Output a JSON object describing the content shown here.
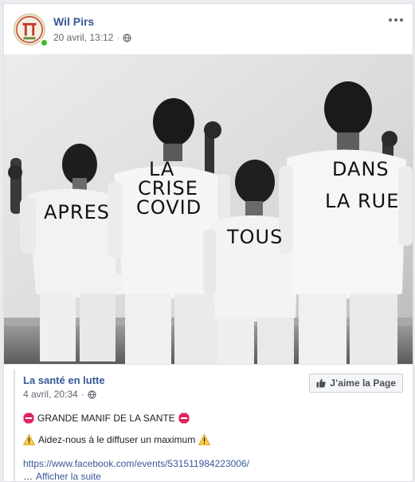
{
  "post": {
    "author": "Wil Pirs",
    "date": "20 avril, 13:12",
    "separator": "·",
    "privacy_icon": "globe-icon",
    "more_icon": "more-dots-icon"
  },
  "photo": {
    "shirt_texts": {
      "left": "APRES",
      "center_line1": "LA",
      "center_line2": "CRISE",
      "center_line3": "COVID",
      "middle": "TOUS",
      "right_line1": "DANS",
      "right_line2": "LA RUE"
    }
  },
  "shared": {
    "page_name": "La santé en lutte",
    "date": "4 avril, 20:34",
    "separator": "·",
    "like_button": "J’aime la Page",
    "line1_text": "GRANDE MANIF DE LA SANTE",
    "line2_text": "Aidez-nous à le diffuser un maximum",
    "link": "https://www.facebook.com/events/531511984223006/",
    "ellipsis": "…",
    "see_more": "Afficher la suite"
  },
  "colors": {
    "link_blue": "#385898",
    "stop_red": "#e0245e",
    "warn_yellow": "#ffcc4d",
    "online_green": "#42b72a"
  }
}
